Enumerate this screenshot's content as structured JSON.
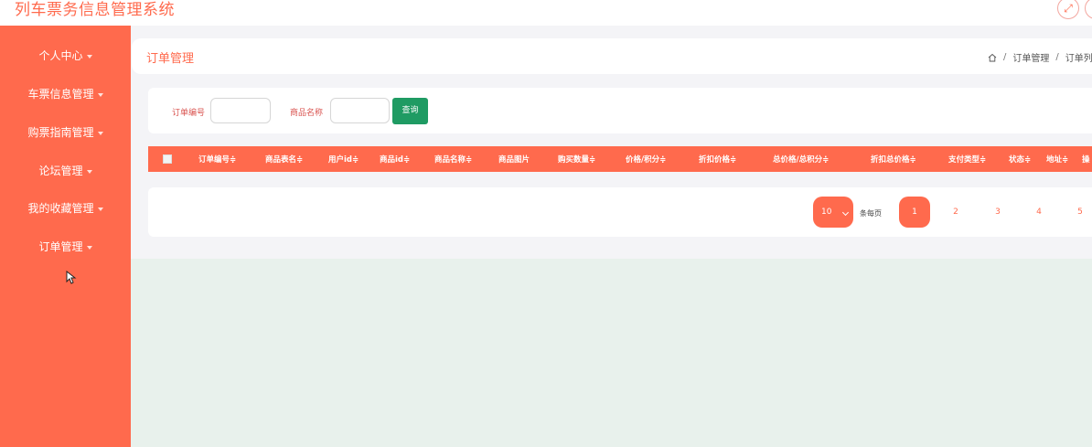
{
  "app": {
    "title": "列车票务信息管理系统"
  },
  "topbar": {
    "fullscreen_icon": "fullscreen-icon",
    "close_icon": "close-icon"
  },
  "sidebar": {
    "items": [
      {
        "label": "个人中心"
      },
      {
        "label": "车票信息管理"
      },
      {
        "label": "购票指南管理"
      },
      {
        "label": "论坛管理"
      },
      {
        "label": "我的收藏管理"
      },
      {
        "label": "订单管理"
      }
    ]
  },
  "header": {
    "title": "订单管理",
    "breadcrumb": [
      "订单管理",
      "订单列表"
    ]
  },
  "search": {
    "order_no_label": "订单编号",
    "order_no_value": "",
    "product_name_label": "商品名称",
    "product_name_value": "",
    "query_label": "查询"
  },
  "table": {
    "columns": [
      "订单编号",
      "商品表名",
      "用户id",
      "商品id",
      "商品名称",
      "商品图片",
      "购买数量",
      "价格/积分",
      "折扣价格",
      "总价格/总积分",
      "折扣总价格",
      "支付类型",
      "状态",
      "地址",
      "操"
    ],
    "sortable": [
      true,
      true,
      true,
      true,
      true,
      false,
      true,
      true,
      true,
      true,
      true,
      true,
      true,
      true,
      false
    ],
    "rows": []
  },
  "pagination": {
    "page_size": "10",
    "per_page_label": "条每页",
    "pages": [
      "1",
      "2",
      "3",
      "4",
      "5"
    ],
    "current": "1"
  },
  "colors": {
    "accent": "#ff6a4d",
    "button": "#1f9b63",
    "background": "#e8f1ec"
  }
}
